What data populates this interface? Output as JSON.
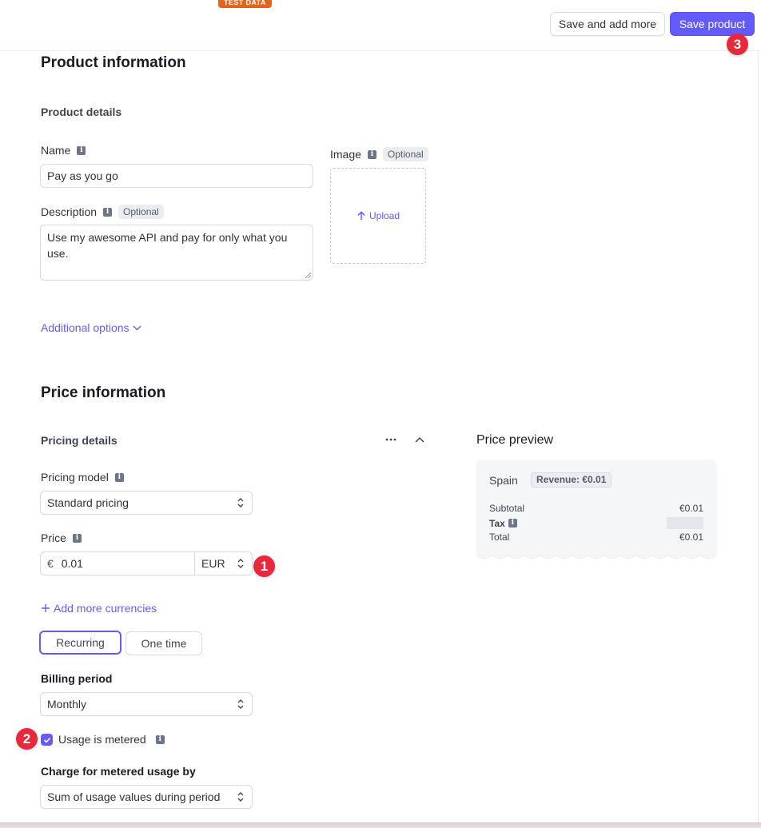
{
  "header": {
    "test_badge": "TEST DATA",
    "save_and_add_more_label": "Save and add more",
    "save_product_label": "Save product"
  },
  "annotations": {
    "step1": "1",
    "step2": "2",
    "step3": "3"
  },
  "product_information": {
    "title": "Product information",
    "subtitle": "Product details",
    "name_label": "Name",
    "name_value": "Pay as you go",
    "description_label": "Description",
    "description_optional": "Optional",
    "description_value": "Use my awesome API and pay for only what you use.",
    "image_label": "Image",
    "image_optional": "Optional",
    "upload_label": "Upload",
    "additional_options_label": "Additional options"
  },
  "price_information": {
    "title": "Price information",
    "pricing_details_label": "Pricing details",
    "pricing_model_label": "Pricing model",
    "pricing_model_value": "Standard pricing",
    "price_label": "Price",
    "currency_symbol": "€",
    "price_value": "0.01",
    "currency_value": "EUR",
    "add_currencies_label": "Add more currencies",
    "type_options": [
      {
        "label": "Recurring",
        "selected": true
      },
      {
        "label": "One time",
        "selected": false
      }
    ],
    "billing_period_label": "Billing period",
    "billing_period_value": "Monthly",
    "usage_metered_label": "Usage is metered",
    "usage_metered_checked": true,
    "charge_metered_label": "Charge for metered usage by",
    "charge_metered_value": "Sum of usage values during period"
  },
  "price_preview": {
    "title": "Price preview",
    "country": "Spain",
    "revenue_badge": "Revenue: €0.01",
    "subtotal_label": "Subtotal",
    "subtotal_value": "€0.01",
    "tax_label": "Tax",
    "total_label": "Total",
    "total_value": "€0.01"
  },
  "colors": {
    "accent": "#635bff",
    "test_badge": "#e5641a",
    "step_marker": "#e8283b"
  }
}
